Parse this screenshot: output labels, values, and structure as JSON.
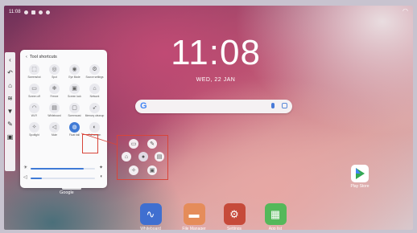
{
  "statusbar": {
    "time": "11:08"
  },
  "clock": {
    "time": "11:08",
    "date": "WED, 22 JAN"
  },
  "panel": {
    "title": "Tool shortcuts",
    "tiles": [
      {
        "label": "Screenshot",
        "icon": "screenshot-icon",
        "glyph": "⬚"
      },
      {
        "label": "Spot",
        "icon": "spotlight-icon",
        "glyph": "◎"
      },
      {
        "label": "Eye Mode",
        "icon": "eye-mode-icon",
        "glyph": "◉"
      },
      {
        "label": "Source settings",
        "icon": "source-icon",
        "glyph": "⚙"
      },
      {
        "label": "Screen off",
        "icon": "screen-off-icon",
        "glyph": "▭"
      },
      {
        "label": "Freeze",
        "icon": "freeze-icon",
        "glyph": "❄"
      },
      {
        "label": "Screen lock",
        "icon": "lock-icon",
        "glyph": "▣"
      },
      {
        "label": "Network",
        "icon": "network-icon",
        "glyph": "⌂"
      },
      {
        "label": "Wi-Fi",
        "icon": "wifi-icon",
        "glyph": "◠"
      },
      {
        "label": "Whiteboard",
        "icon": "whiteboard-icon",
        "glyph": "▤"
      },
      {
        "label": "Screencast",
        "icon": "screencast-icon",
        "glyph": "▢"
      },
      {
        "label": "Memory cleanup",
        "icon": "rocket-icon",
        "glyph": "➶"
      },
      {
        "label": "Spotlight",
        "icon": "light-icon",
        "glyph": "✧"
      },
      {
        "label": "Mute",
        "icon": "mute-icon",
        "glyph": "◁"
      },
      {
        "label": "Float ball",
        "icon": "float-ball-icon",
        "glyph": "◍",
        "active": true
      },
      {
        "label": "Full screen",
        "icon": "eye-icon",
        "glyph": "◐"
      }
    ]
  },
  "sliders": {
    "brightness": 0.82,
    "volume": 0.18
  },
  "home": {
    "google_label": "Google",
    "playstore_label": "Play Store"
  },
  "dock": [
    {
      "label": "Whiteboard",
      "icon": "whiteboard-app-icon",
      "color": "#3f6fd0",
      "glyph": "∿"
    },
    {
      "label": "File Manager",
      "icon": "folder-app-icon",
      "color": "#e58c5a",
      "glyph": "▬"
    },
    {
      "label": "Settings",
      "icon": "settings-app-icon",
      "color": "#c64a3a",
      "glyph": "⚙"
    },
    {
      "label": "App list",
      "icon": "app-list-icon",
      "color": "#55b85a",
      "glyph": "▦"
    }
  ]
}
